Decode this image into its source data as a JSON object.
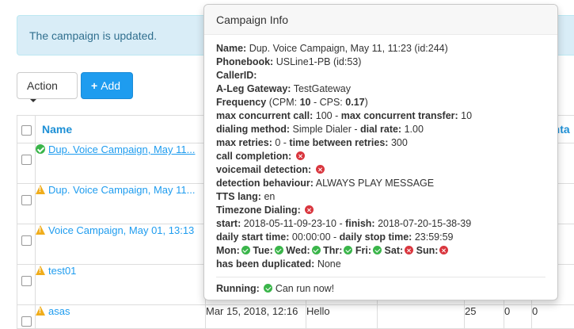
{
  "alert": {
    "text": "The campaign is updated."
  },
  "toolbar": {
    "action_label": "Action",
    "add_label": "Add"
  },
  "table": {
    "header_name": "Name",
    "header_right": "Conta",
    "rows": [
      {
        "name": "Dup. Voice Campaign, May 11...",
        "status": "ok"
      },
      {
        "name": "Dup. Voice Campaign, May 11...",
        "status": "warn"
      },
      {
        "name": "Voice Campaign, May 01, 13:13",
        "status": "warn"
      },
      {
        "name": "test01",
        "status": "warn"
      },
      {
        "name": "asas",
        "status": "warn",
        "date": "Mar 15, 2018, 12:16",
        "desc": "Hello",
        "c1": "25",
        "c2": "0",
        "c3": "0"
      }
    ]
  },
  "popover": {
    "title": "Campaign Info",
    "name_label": "Name:",
    "name_value": "Dup. Voice Campaign, May 11, 11:23 (id:244)",
    "phonebook_label": "Phonebook:",
    "phonebook_value": "USLine1-PB (id:53)",
    "callerid_label": "CallerID:",
    "gateway_label": "A-Leg Gateway:",
    "gateway_value": "TestGateway",
    "frequency_label": "Frequency",
    "frequency_pre": "(CPM: ",
    "cpm": "10",
    "frequency_mid": " - CPS: ",
    "cps": "0.17",
    "frequency_post": ")",
    "max_call_label": "max concurrent call:",
    "max_call_value": "100",
    "max_transfer_label": "max concurrent transfer:",
    "max_transfer_value": "10",
    "dialing_method_label": "dialing method:",
    "dialing_method_value": "Simple Dialer",
    "dial_rate_label": "dial rate:",
    "dial_rate_value": "1.00",
    "max_retries_label": "max retries:",
    "max_retries_value": "0",
    "retry_time_label": "time between retries:",
    "retry_time_value": "300",
    "call_completion_label": "call completion:",
    "voicemail_label": "voicemail detection:",
    "detection_label": "detection behaviour:",
    "detection_value": "ALWAYS PLAY MESSAGE",
    "tts_label": "TTS lang:",
    "tts_value": "en",
    "timezone_label": "Timezone Dialing:",
    "start_label": "start:",
    "start_value": "2018-05-11-09-23-10",
    "finish_label": "finish:",
    "finish_value": "2018-07-20-15-38-39",
    "daily_start_label": "daily start time:",
    "daily_start_value": "00:00:00",
    "daily_stop_label": "daily stop time:",
    "daily_stop_value": "23:59:59",
    "days": [
      {
        "label": "Mon:",
        "on": true
      },
      {
        "label": "Tue:",
        "on": true
      },
      {
        "label": "Wed:",
        "on": true
      },
      {
        "label": "Thr:",
        "on": true
      },
      {
        "label": "Fri:",
        "on": true
      },
      {
        "label": "Sat:",
        "on": false
      },
      {
        "label": "Sun:",
        "on": false
      }
    ],
    "duplicated_label": "has been duplicated:",
    "duplicated_value": "None",
    "running_label": "Running:",
    "running_value": "Can run now!"
  }
}
